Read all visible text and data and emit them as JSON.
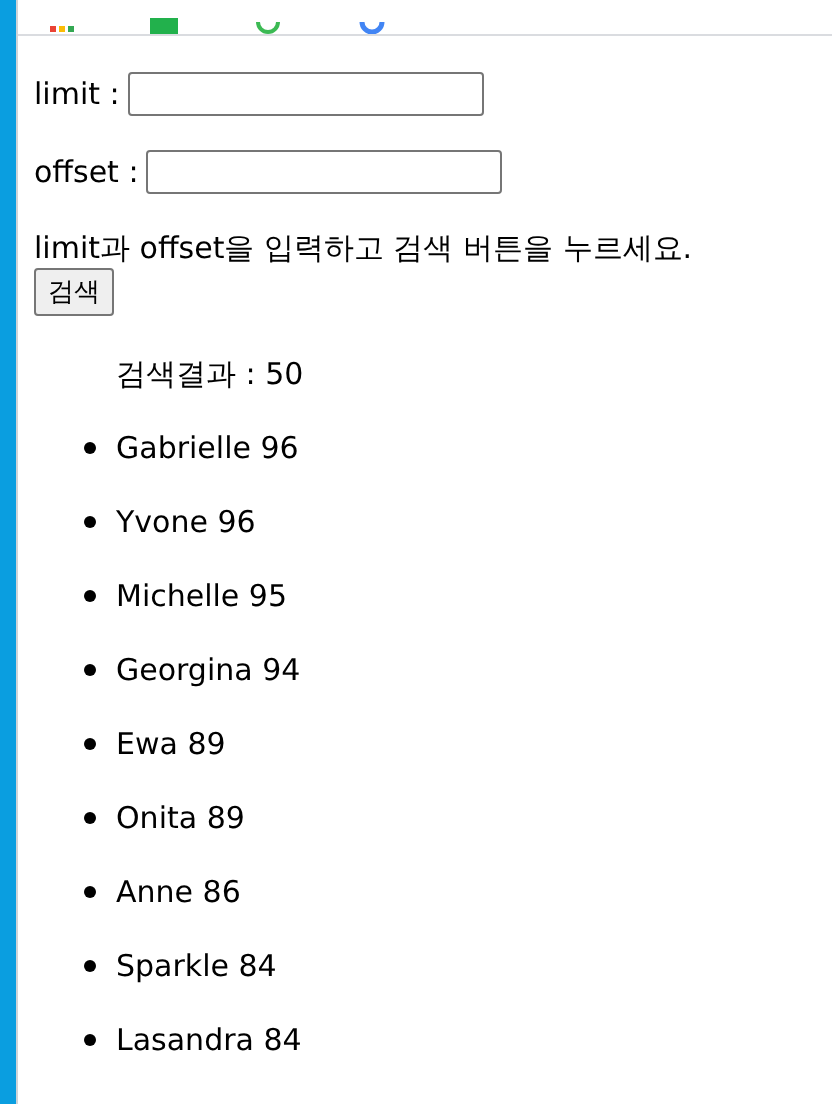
{
  "form": {
    "fields": [
      {
        "label": "limit :"
      },
      {
        "label": "offset :"
      }
    ],
    "instruction": "limit과 offset을 입력하고 검색 버튼을 누르세요.",
    "button": "검색"
  },
  "result": {
    "summary": "검색결과 : 50",
    "items": [
      "Gabrielle 96",
      "Yvone 96",
      "Michelle 95",
      "Georgina 94",
      "Ewa 89",
      "Onita 89",
      "Anne 86",
      "Sparkle 84",
      "Lasandra 84"
    ]
  }
}
